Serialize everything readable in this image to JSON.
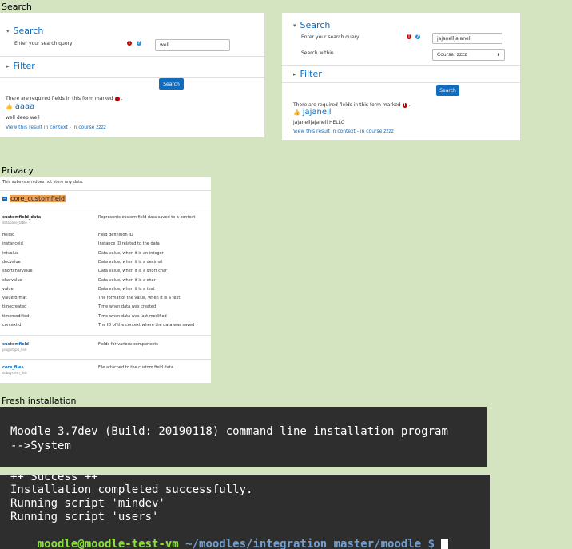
{
  "headings": {
    "search": "Search",
    "privacy": "Privacy",
    "fresh_install": "Fresh installation"
  },
  "search_left": {
    "section_search": "Search",
    "query_label": "Enter your search query",
    "query_value": "well",
    "section_filter": "Filter",
    "search_button": "Search",
    "required_note": "There are required fields in this form marked",
    "result_title": "aaaa",
    "result_text": "well deep well",
    "result_link": "View this result in context",
    "result_sep": " - ",
    "result_course": "in course zzzz"
  },
  "search_right": {
    "section_search": "Search",
    "query_label": "Enter your search query",
    "query_value": "jajanelljajanell",
    "within_label": "Search within",
    "within_value": "Course: zzzz",
    "section_filter": "Filter",
    "search_button": "Search",
    "required_note": "There are required fields in this form marked",
    "result_title": "jajanell",
    "result_text": "jajanelljajanell HELLO",
    "result_link": "View this result in context",
    "result_sep": " - ",
    "result_course": "in course zzzz"
  },
  "privacy": {
    "no_data": "This subsystem does not store any data.",
    "component": "core_customfield",
    "table_name": "customfield_data",
    "table_type": "database_table",
    "table_desc": "Represents custom field data saved to a context",
    "fields": [
      {
        "k": "fieldid",
        "v": "Field definition ID"
      },
      {
        "k": "instanceid",
        "v": "Instance ID related to the data"
      },
      {
        "k": "intvalue",
        "v": "Data value, when it is an integer"
      },
      {
        "k": "decvalue",
        "v": "Data value, when it is a decimal"
      },
      {
        "k": "shortcharvalue",
        "v": "Data value, when it is a short char"
      },
      {
        "k": "charvalue",
        "v": "Data value, when it is a char"
      },
      {
        "k": "value",
        "v": "Data value, when it is a text"
      },
      {
        "k": "valueformat",
        "v": "The format of the value, when it is a text"
      },
      {
        "k": "timecreated",
        "v": "Time when data was created"
      },
      {
        "k": "timemodified",
        "v": "Time when data was last modified"
      },
      {
        "k": "contextid",
        "v": "The ID of the context where the data was saved"
      }
    ],
    "link1_name": "customfield",
    "link1_type": "plugintype_link",
    "link1_desc": "Fields for various components",
    "link2_name": "core_files",
    "link2_type": "subsystem_link",
    "link2_desc": "File attached to the custom field data"
  },
  "terminal1": {
    "line1": "Moodle 3.7dev (Build: 20190118) command line installation program",
    "line2": "-->System"
  },
  "terminal2": {
    "line1": "++ Success ++",
    "line2": "Installation completed successfully.",
    "line3": "Running script 'mindev'",
    "line4": "Running script 'users'",
    "prompt_user": "moodle@moodle-test-vm",
    "prompt_path": " ~/moodles/integration_master/moodle $ "
  },
  "colors": {
    "background": "#d4e3c0",
    "link": "#0f6cbf",
    "prompt_green": "#8ae234",
    "prompt_blue": "#729fcf",
    "highlight": "#f0a050"
  }
}
